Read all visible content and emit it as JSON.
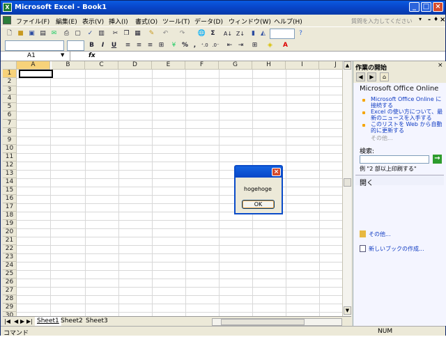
{
  "window": {
    "title": "Microsoft Excel - Book1",
    "app_icon": "excel-icon",
    "min": "_",
    "max": "□",
    "close": "×"
  },
  "menubar": {
    "items": [
      "ファイル(F)",
      "編集(E)",
      "表示(V)",
      "挿入(I)",
      "書式(O)",
      "ツール(T)",
      "データ(D)",
      "ウィンドウ(W)",
      "ヘルプ(H)"
    ],
    "help_placeholder": "質問を入力してください",
    "help_dropdown": "▾",
    "doc_min": "-",
    "doc_restore": "♦",
    "doc_close": "×"
  },
  "toolbar": {
    "font_bold": "B",
    "font_italic": "I",
    "font_underline": "U",
    "percent": "%",
    "comma": ",",
    "sum": "Σ",
    "sort_asc": "A↓",
    "sort_desc": "Z↓"
  },
  "formula_bar": {
    "name_box": "A1",
    "fx": "fx",
    "value": ""
  },
  "grid": {
    "columns": [
      "A",
      "B",
      "C",
      "D",
      "E",
      "F",
      "G",
      "H",
      "I",
      "J"
    ],
    "rows": [
      "1",
      "2",
      "3",
      "4",
      "5",
      "6",
      "7",
      "8",
      "9",
      "10",
      "11",
      "12",
      "13",
      "14",
      "15",
      "16",
      "17",
      "18",
      "19",
      "20",
      "21",
      "22",
      "23",
      "24",
      "25",
      "26",
      "27",
      "28",
      "29",
      "30"
    ],
    "active_cell": "A1"
  },
  "sheets": {
    "tabs": [
      "Sheet1",
      "Sheet2",
      "Sheet3"
    ],
    "active": "Sheet1",
    "nav": [
      "|◀",
      "◀",
      "▶",
      "▶|"
    ]
  },
  "statusbar": {
    "left": "コマンド",
    "num": "NUM"
  },
  "taskpane": {
    "title": "作業の開始",
    "nav_back": "◀",
    "nav_fwd": "▶",
    "home": "⌂",
    "heading": "Microsoft Office Online",
    "links": [
      "Microsoft Office Online に接続する",
      "Excel の使い方について、最新のニュースを入手する",
      "このリストを Web から自動的に更新する"
    ],
    "more": "その他...",
    "search_label": "検索:",
    "search_go": "→",
    "example": "例 \"2 部以上印刷する\"",
    "open_heading": "開く",
    "open_more": "その他...",
    "new_book": "新しいブックの作成..."
  },
  "dialog": {
    "close": "×",
    "message": "hogehoge",
    "ok": "OK"
  },
  "colors": {
    "title_bar": "#0845c8",
    "dialog_border": "#0a4bc8",
    "accent_green": "#1d7a2f"
  }
}
